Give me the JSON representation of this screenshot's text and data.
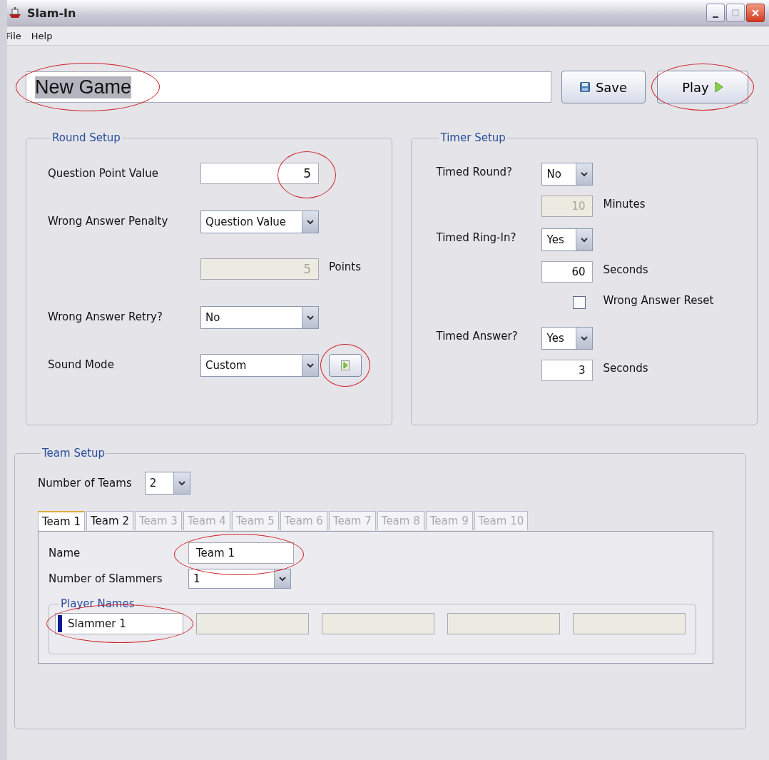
{
  "window": {
    "title": "Slam-In"
  },
  "menu": [
    {
      "label": "File"
    },
    {
      "label": "Help"
    }
  ],
  "game_name": {
    "value": "New Game",
    "circled": true
  },
  "buttons": [
    {
      "kind": "save",
      "label": "Save",
      "circled": false
    },
    {
      "kind": "play",
      "label": "Play",
      "circled": true
    }
  ],
  "round_setup": {
    "title": "Round Setup",
    "rows": [
      {
        "kind": "text",
        "label": "Question Point Value",
        "value": "5",
        "disabled": false,
        "circled": true
      },
      {
        "kind": "select",
        "label": "Wrong Answer Penalty",
        "value": "Question Value"
      },
      {
        "kind": "text",
        "value": "5",
        "unit": "Points",
        "disabled": true
      },
      {
        "kind": "select",
        "label": "Wrong Answer Retry?",
        "value": "No"
      },
      {
        "kind": "select_play",
        "label": "Sound Mode",
        "value": "Custom",
        "circled": true
      }
    ]
  },
  "timer_setup": {
    "title": "Timer Setup",
    "rows": [
      {
        "kind": "select",
        "label": "Timed Round?",
        "value": "No"
      },
      {
        "kind": "text",
        "value": "10",
        "unit": "Minutes",
        "disabled": true
      },
      {
        "kind": "select",
        "label": "Timed Ring-In?",
        "value": "Yes"
      },
      {
        "kind": "text",
        "value": "60",
        "unit": "Seconds",
        "disabled": false
      },
      {
        "kind": "checkbox",
        "label": "Wrong Answer Reset",
        "checked": false
      },
      {
        "kind": "select",
        "label": "Timed Answer?",
        "value": "Yes"
      },
      {
        "kind": "text",
        "value": "3",
        "unit": "Seconds",
        "disabled": false
      }
    ]
  },
  "team_setup": {
    "title": "Team Setup",
    "number_of_teams": {
      "label": "Number of Teams",
      "value": "2"
    },
    "tabs": [
      {
        "label": "Team 1",
        "selected": true,
        "disabled": false
      },
      {
        "label": "Team 2",
        "selected": false,
        "disabled": false
      },
      {
        "label": "Team 3",
        "selected": false,
        "disabled": true
      },
      {
        "label": "Team 4",
        "selected": false,
        "disabled": true
      },
      {
        "label": "Team 5",
        "selected": false,
        "disabled": true
      },
      {
        "label": "Team 6",
        "selected": false,
        "disabled": true
      },
      {
        "label": "Team 7",
        "selected": false,
        "disabled": true
      },
      {
        "label": "Team 8",
        "selected": false,
        "disabled": true
      },
      {
        "label": "Team 9",
        "selected": false,
        "disabled": true
      },
      {
        "label": "Team 10",
        "selected": false,
        "disabled": true
      }
    ],
    "name": {
      "label": "Name",
      "value": "Team 1",
      "circled": true
    },
    "slammers": {
      "label": "Number of Slammers",
      "value": "1"
    },
    "player_names": {
      "title": "Player Names",
      "fields": [
        {
          "value": "Slammer 1",
          "disabled": false,
          "focused": true,
          "circled": true
        },
        {
          "disabled": true
        },
        {
          "disabled": true
        },
        {
          "disabled": true
        },
        {
          "disabled": true
        }
      ]
    }
  }
}
